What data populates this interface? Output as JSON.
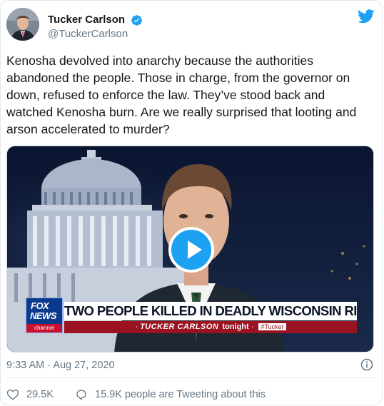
{
  "author": {
    "display_name": "Tucker Carlson",
    "handle": "@TuckerCarlson",
    "verified": true,
    "avatar_icon": "avatar-photo"
  },
  "brand_icon": "twitter-bird-icon",
  "tweet": {
    "text": "Kenosha devolved into anarchy because the authorities abandoned the people. Those in charge, from the governor on down, refused to enforce the law. They’ve stood back and watched Kenosha burn. Are we really surprised that looting and arson accelerated to murder?"
  },
  "media": {
    "type": "video",
    "play_icon": "play-icon",
    "logo": {
      "top": "FOX",
      "bottom": "NEWS",
      "channel": "channel"
    },
    "headline": "TWO PEOPLE KILLED IN DEADLY WISCONSIN RIOTS",
    "show_name": "TUCKER CARLSON",
    "show_suffix": "tonight",
    "hashtag": "#Tucker"
  },
  "meta": {
    "timestamp": "9:33 AM · Aug 27, 2020",
    "info_icon": "info-icon"
  },
  "actions": {
    "likes": "29.5K",
    "replies_text": "15.9K people are Tweeting about this"
  },
  "colors": {
    "brand_blue": "#1da1f2",
    "text_primary": "#14171a",
    "text_secondary": "#657786",
    "fox_blue": "#0b3a8c",
    "fox_red": "#9b1221"
  }
}
